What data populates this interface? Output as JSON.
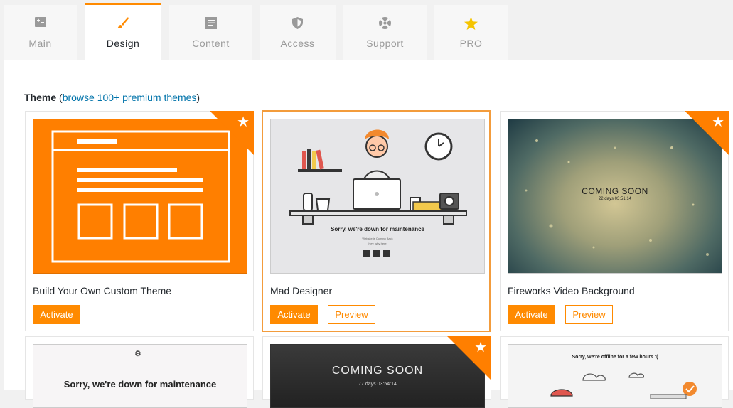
{
  "tabs": [
    {
      "label": "Main",
      "icon": "dashboard-icon"
    },
    {
      "label": "Design",
      "icon": "paintbrush-icon"
    },
    {
      "label": "Content",
      "icon": "content-icon"
    },
    {
      "label": "Access",
      "icon": "shield-icon"
    },
    {
      "label": "Support",
      "icon": "support-icon"
    },
    {
      "label": "PRO",
      "icon": "star-icon"
    }
  ],
  "theme_section": {
    "title": "Theme",
    "link_open": "(",
    "link": "browse 100+ premium themes",
    "link_close": ")"
  },
  "themes": [
    {
      "name": "Build Your Own Custom Theme",
      "activate": "Activate"
    },
    {
      "name": "Mad Designer",
      "activate": "Activate",
      "preview": "Preview",
      "thumb_title": "Sorry, we're down for maintenance",
      "thumb_sub1": "Website is Coming Back",
      "thumb_sub2": "Hey, why here"
    },
    {
      "name": "Fireworks Video Background",
      "activate": "Activate",
      "preview": "Preview",
      "thumb_title": "COMING SOON",
      "thumb_sub": "22 days 03:51:14"
    },
    {
      "thumb_title": "Sorry, we're down for maintenance"
    },
    {
      "thumb_title": "COMING SOON",
      "thumb_sub": "77 days 03:54:14"
    },
    {
      "thumb_title": "Sorry, we're offline for a few hours :("
    }
  ],
  "colors": {
    "accent": "#ff8a00",
    "link": "#0073aa"
  }
}
